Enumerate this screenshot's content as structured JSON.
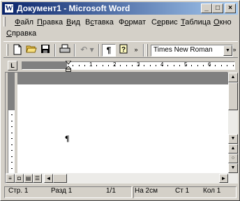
{
  "window": {
    "title": "Документ1 - Microsoft Word",
    "app_icon": "W",
    "controls": {
      "minimize": "_",
      "maximize": "□",
      "close": "×"
    }
  },
  "menu": {
    "items": [
      {
        "label": "Файл",
        "accel_index": 0
      },
      {
        "label": "Правка",
        "accel_index": 0
      },
      {
        "label": "Вид",
        "accel_index": 0
      },
      {
        "label": "Вставка",
        "accel_index": 1
      },
      {
        "label": "Формат",
        "accel_index": 1
      },
      {
        "label": "Сервис",
        "accel_index": 1
      },
      {
        "label": "Таблица",
        "accel_index": 0
      },
      {
        "label": "Окно",
        "accel_index": 0
      },
      {
        "label": "Справка",
        "accel_index": 0
      }
    ]
  },
  "toolbar": {
    "icons": [
      "new-icon",
      "open-icon",
      "save-icon",
      "print-icon",
      "undo-icon",
      "show-marks-icon",
      "help-icon"
    ],
    "font_name": "Times New Roman"
  },
  "ruler": {
    "tab_selector": "L",
    "numbers": [
      "1",
      "2",
      "3",
      "4",
      "5",
      "6"
    ]
  },
  "document": {
    "paragraph_mark": "¶"
  },
  "statusbar": {
    "page": "Стр. 1",
    "section": "Разд 1",
    "pages": "1/1",
    "at": "На 2см",
    "line": "Ст 1",
    "col": "Кол 1"
  }
}
